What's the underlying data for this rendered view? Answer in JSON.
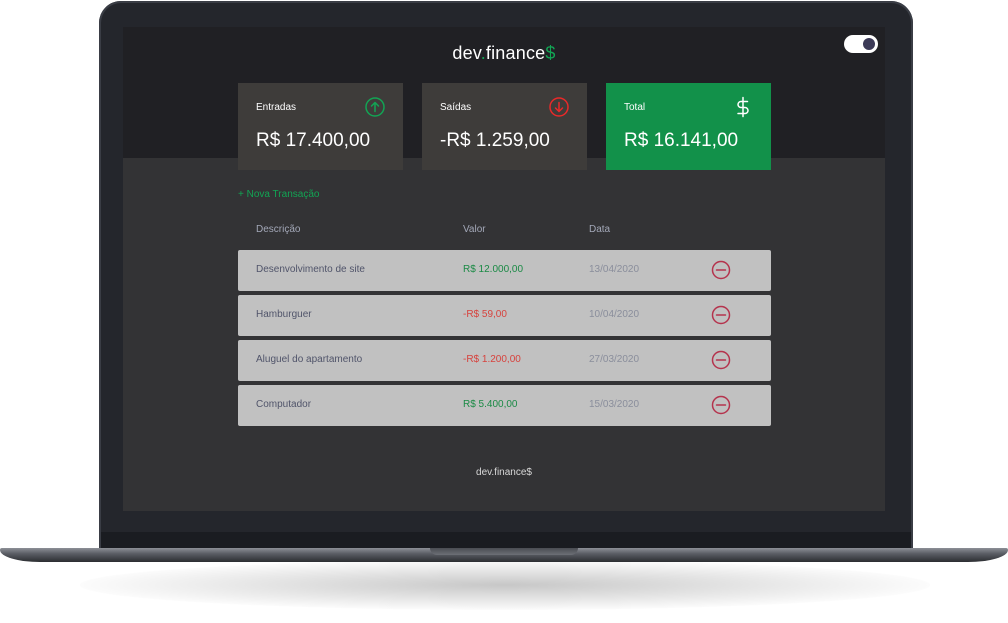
{
  "app": {
    "logo_main": "dev",
    "logo_dot": ".",
    "logo_rest": "finance",
    "logo_dollar": "$"
  },
  "theme_toggle": {
    "state": "dark"
  },
  "cards": [
    {
      "label": "Entradas",
      "value": "R$ 17.400,00",
      "icon": "arrow-up-circle-icon",
      "icon_color": "#12a454"
    },
    {
      "label": "Saídas",
      "value": "-R$ 1.259,00",
      "icon": "arrow-down-circle-icon",
      "icon_color": "#e92929"
    },
    {
      "label": "Total",
      "value": "R$ 16.141,00",
      "icon": "dollar-icon",
      "bg_color": "#12914a"
    }
  ],
  "new_transaction_label": "+ Nova Transação",
  "table": {
    "headers": [
      "Descrição",
      "Valor",
      "Data"
    ],
    "rows": [
      {
        "description": "Desenvolvimento de site",
        "amount": "R$ 12.000,00",
        "type": "income",
        "date": "13/04/2020"
      },
      {
        "description": "Hamburguer",
        "amount": "-R$ 59,00",
        "type": "expense",
        "date": "10/04/2020"
      },
      {
        "description": "Aluguel do apartamento",
        "amount": "-R$ 1.200,00",
        "type": "expense",
        "date": "27/03/2020"
      },
      {
        "description": "Computador",
        "amount": "R$ 5.400,00",
        "type": "income",
        "date": "15/03/2020"
      }
    ]
  },
  "footer": "dev.finance$",
  "colors": {
    "income": "#12a454",
    "expense": "#e92929",
    "header_bg": "#202024",
    "body_bg": "#333335"
  }
}
